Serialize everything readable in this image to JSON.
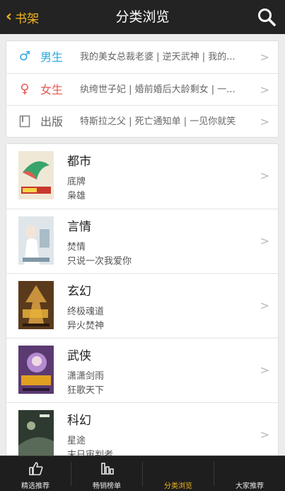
{
  "header": {
    "back_label": "书架",
    "title": "分类浏览"
  },
  "gender": [
    {
      "icon": "♂",
      "color": "#2aa7e0",
      "label": "男生",
      "desc": "我的美女总裁老婆 | 逆天武神 | 我的..."
    },
    {
      "icon": "♀",
      "color": "#e55a54",
      "label": "女生",
      "desc": "纨绔世子妃 | 婚前婚后大龄剩女 | 一..."
    },
    {
      "icon": "book",
      "color": "#888888",
      "label": "出版",
      "desc": "特斯拉之父 | 死亡通知单 | 一见你就笑"
    }
  ],
  "categories": [
    {
      "name": "都市",
      "book1": "底牌",
      "book2": "枭雄",
      "cover_color": "#e2d6b5"
    },
    {
      "name": "言情",
      "book1": "焚情",
      "book2": "只说一次我爱你",
      "cover_color": "#cfd8de"
    },
    {
      "name": "玄幻",
      "book1": "终极魂道",
      "book2": "异火焚神",
      "cover_color": "#8a5a2a"
    },
    {
      "name": "武侠",
      "book1": "潇潇剑雨",
      "book2": "狂歌天下",
      "cover_color": "#7a4a8a"
    },
    {
      "name": "科幻",
      "book1": "星途",
      "book2": "末日审判者",
      "cover_color": "#3a4a3a"
    }
  ],
  "nav": [
    {
      "label": "精选推荐",
      "active": false
    },
    {
      "label": "畅销榜单",
      "active": false
    },
    {
      "label": "分类浏览",
      "active": true
    },
    {
      "label": "大家推荐",
      "active": false
    }
  ],
  "colors": {
    "accent": "#f2b51d",
    "header_bg": "#232323"
  }
}
